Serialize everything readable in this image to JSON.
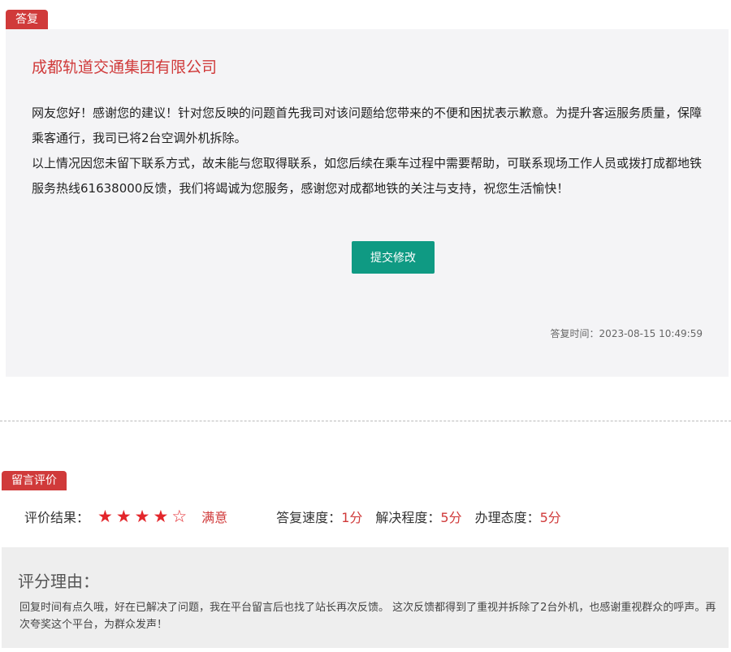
{
  "reply": {
    "tag_label": "答复",
    "company": "成都轨道交通集团有限公司",
    "paragraphs": [
      "网友您好！感谢您的建议！针对您反映的问题首先我司对该问题给您带来的不便和困扰表示歉意。为提升客运服务质量，保障乘客通行，我司已将2台空调外机拆除。",
      "以上情况因您未留下联系方式，故未能与您取得联系，如您后续在乘车过程中需要帮助，可联系现场工作人员或拨打成都地铁服务热线61638000反馈，我们将竭诚为您服务，感谢您对成都地铁的关注与支持，祝您生活愉快！"
    ],
    "submit_label": "提交修改",
    "time_label": "答复时间：",
    "time_value": "2023-08-15 10:49:59"
  },
  "evaluation": {
    "tag_label": "留言评价",
    "result_label": "评价结果：",
    "rating": 4,
    "max_rating": 5,
    "star_color": "#e3262b",
    "rating_text": "满意",
    "scores": [
      {
        "label": "答复速度：",
        "value": "1分"
      },
      {
        "label": "解决程度：",
        "value": "5分"
      },
      {
        "label": "办理态度：",
        "value": "5分"
      }
    ],
    "reason_title": "评分理由：",
    "reason_text": "回复时间有点久哦，好在已解决了问题，我在平台留言后也找了站长再次反馈。 这次反馈都得到了重视并拆除了2台外机，也感谢重视群众的呼声。再次夸奖这个平台，为群众发声！"
  },
  "colors": {
    "accent_red": "#d03a3a",
    "button_green": "#0f9a83",
    "panel_bg": "#f4f4f6"
  }
}
